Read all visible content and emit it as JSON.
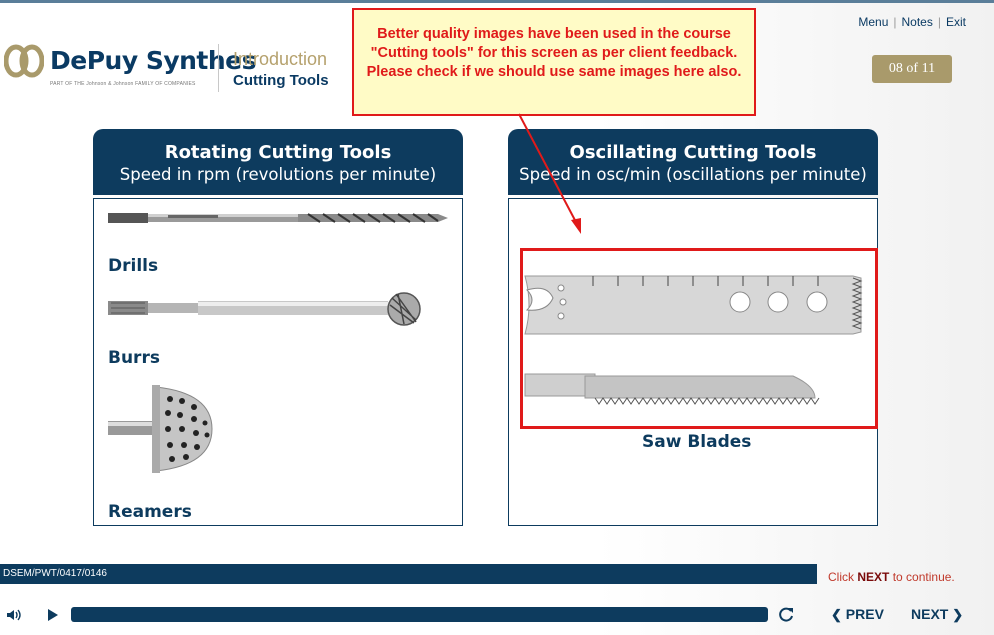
{
  "header": {
    "brand": "DePuy Synthes",
    "brand_sub": "PART OF THE Johnson & Johnson FAMILY OF COMPANIES",
    "breadcrumb_title": "Introduction",
    "breadcrumb_sub": "Cutting Tools"
  },
  "topmenu": {
    "menu": "Menu",
    "notes": "Notes",
    "exit": "Exit",
    "sep": "|"
  },
  "page_indicator": "08 of 11",
  "review_note": "Better quality images have been used in the course \"Cutting tools\" for this screen as per client feedback. Please check if we should use same images here also.",
  "left_panel": {
    "title": "Rotating Cutting Tools",
    "subtitle": "Speed in rpm (revolutions per minute)",
    "items": [
      "Drills",
      "Burrs",
      "Reamers"
    ]
  },
  "right_panel": {
    "title": "Oscillating Cutting Tools",
    "subtitle": "Speed in osc/min (oscillations per minute)",
    "items": [
      "Saw Blades"
    ]
  },
  "footer": {
    "code": "DSEM/PWT/0417/0146",
    "hint_pre": "Click",
    "hint_next": "NEXT",
    "hint_post": "to continue.",
    "prev": "PREV",
    "next": "NEXT"
  },
  "colors": {
    "navy": "#0d3b5e",
    "gold": "#a99a6b",
    "review_red": "#e01a1a",
    "note_bg": "#fffbc6"
  },
  "icons": [
    "logo-icon",
    "volume-icon",
    "play-icon",
    "replay-icon",
    "chevron-left-icon",
    "chevron-right-icon"
  ]
}
